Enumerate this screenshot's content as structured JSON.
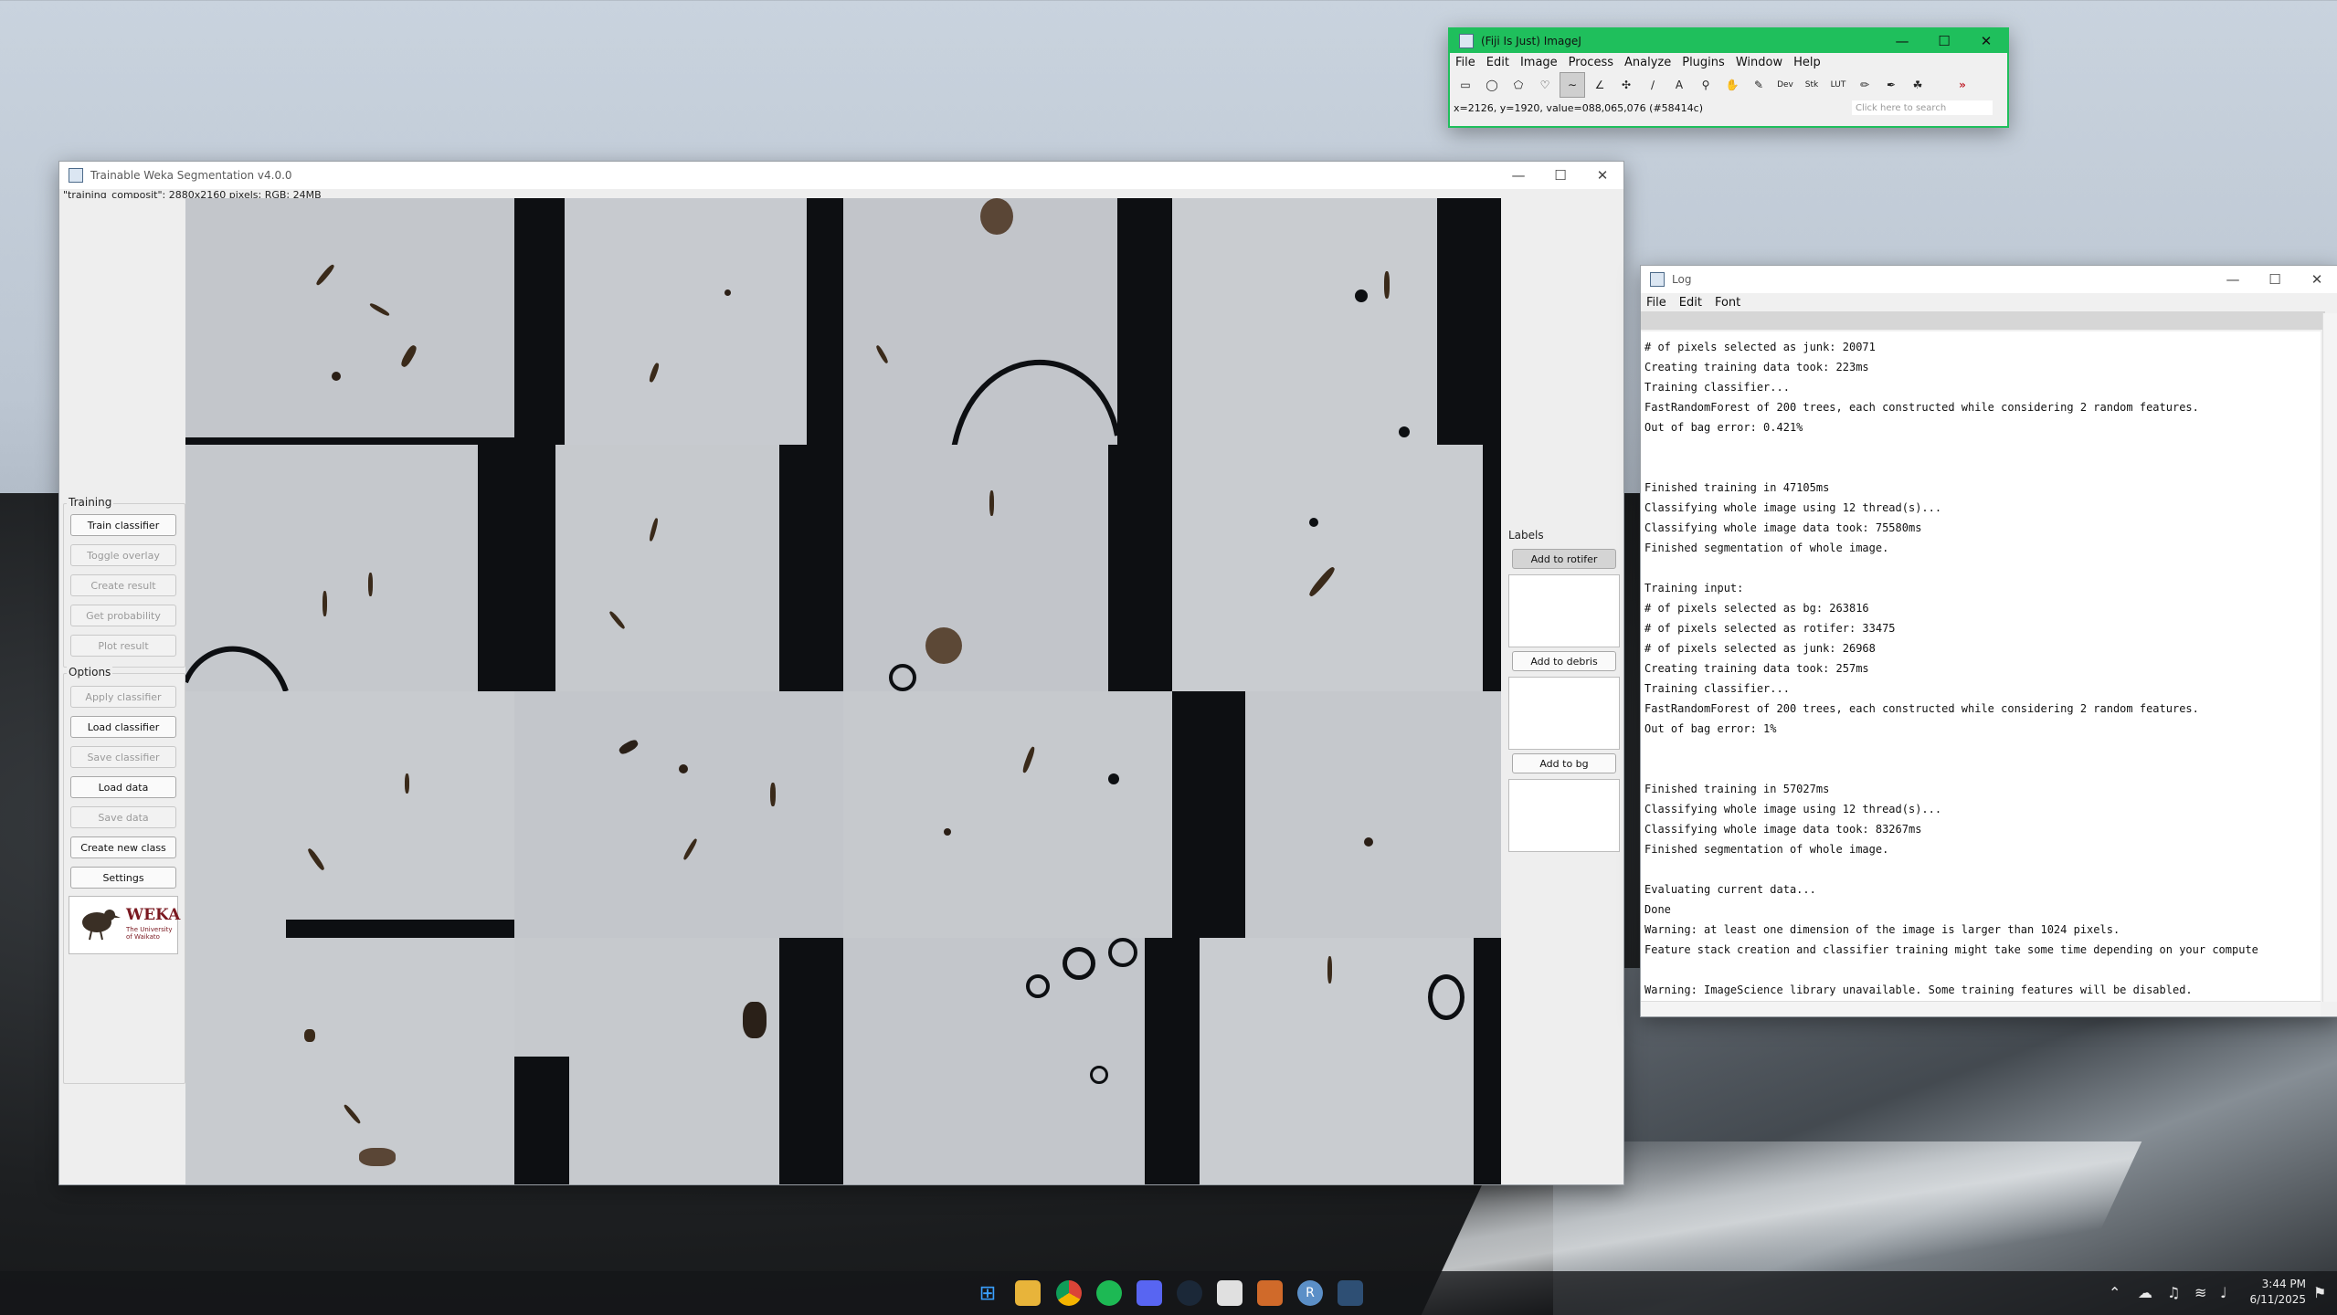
{
  "weka": {
    "title": "Trainable Weka Segmentation v4.0.0",
    "info": "\"training_composit\": 2880x2160 pixels; RGB; 24MB",
    "training_label": "Training",
    "options_label": "Options",
    "buttons": {
      "train": "Train classifier",
      "toggle": "Toggle overlay",
      "create_result": "Create result",
      "get_probability": "Get probability",
      "plot_result": "Plot result",
      "apply": "Apply classifier",
      "load_classifier": "Load classifier",
      "save_classifier": "Save classifier",
      "load_data": "Load data",
      "save_data": "Save data",
      "create_class": "Create new class",
      "settings": "Settings"
    },
    "logo": {
      "name": "WEKA",
      "sub": "The University of Waikato"
    },
    "labels_title": "Labels",
    "label_buttons": [
      "Add to rotifer",
      "Add to debris",
      "Add to bg"
    ]
  },
  "imagej": {
    "title": "(Fiji Is Just) ImageJ",
    "menu": [
      "File",
      "Edit",
      "Image",
      "Process",
      "Analyze",
      "Plugins",
      "Window",
      "Help"
    ],
    "status": "x=2126, y=1920, value=088,065,076 (#58414c)",
    "search_placeholder": "Click here to search",
    "tools": [
      "rectangle-tool-icon",
      "oval-tool-icon",
      "polygon-tool-icon",
      "freehand-tool-icon",
      "line-tool-icon",
      "angle-tool-icon",
      "point-tool-icon",
      "wand-tool-icon",
      "text-tool-icon",
      "magnifier-tool-icon",
      "hand-tool-icon",
      "dropper-tool-icon",
      "dev-tool-icon",
      "stk-tool-icon",
      "lut-tool-icon",
      "pencil-tool-icon",
      "brush-tool-icon",
      "flood-fill-tool-icon",
      "more-tools-icon"
    ],
    "tool_text": {
      "dev": "Dev",
      "stk": "Stk",
      "lut": "LUT"
    }
  },
  "log": {
    "title": "Log",
    "menu": [
      "File",
      "Edit",
      "Font"
    ],
    "lines": [
      "# of pixels selected as junk: 20071",
      "Creating training data took: 223ms",
      "Training classifier...",
      "FastRandomForest of 200 trees, each constructed while considering 2 random features.",
      "Out of bag error: 0.421%",
      "",
      "",
      "Finished training in 47105ms",
      "Classifying whole image using 12 thread(s)...",
      "Classifying whole image data took: 75580ms",
      "Finished segmentation of whole image.",
      "",
      "Training input:",
      "# of pixels selected as bg: 263816",
      "# of pixels selected as rotifer: 33475",
      "# of pixels selected as junk: 26968",
      "Creating training data took: 257ms",
      "Training classifier...",
      "FastRandomForest of 200 trees, each constructed while considering 2 random features.",
      "Out of bag error: 1%",
      "",
      "",
      "Finished training in 57027ms",
      "Classifying whole image using 12 thread(s)...",
      "Classifying whole image data took: 83267ms",
      "Finished segmentation of whole image.",
      "",
      "Evaluating current data...",
      "Done",
      "Warning: at least one dimension of the image is larger than 1024 pixels.",
      "Feature stack creation and classifier training might take some time depending on your compute",
      "",
      "Warning: ImageScience library unavailable. Some training features will be disabled."
    ]
  },
  "taskbar": {
    "apps": [
      "windows-start-icon",
      "file-explorer-icon",
      "chrome-icon",
      "spotify-icon",
      "discord-icon",
      "steam-icon",
      "app-icon",
      "app-icon-2",
      "r-icon",
      "fiji-icon"
    ],
    "time": "3:44 PM",
    "date": "6/11/2025"
  }
}
